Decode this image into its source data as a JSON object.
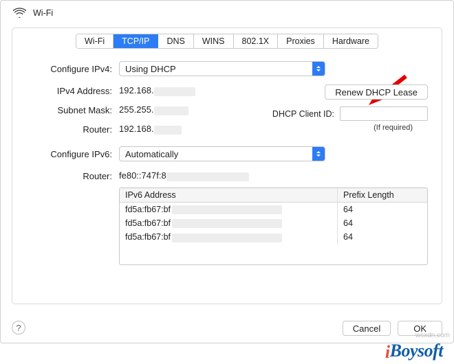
{
  "header": {
    "title": "Wi-Fi"
  },
  "tabs": [
    "Wi-Fi",
    "TCP/IP",
    "DNS",
    "WINS",
    "802.1X",
    "Proxies",
    "Hardware"
  ],
  "active_tab_index": 1,
  "labels": {
    "configure_ipv4": "Configure IPv4:",
    "ipv4_address": "IPv4 Address:",
    "subnet_mask": "Subnet Mask:",
    "router": "Router:",
    "configure_ipv6": "Configure IPv6:",
    "router6": "Router:",
    "dhcp_client_id": "DHCP Client ID:",
    "if_required": "(If required)"
  },
  "values": {
    "configure_ipv4": "Using DHCP",
    "ipv4_address": "192.168.",
    "subnet_mask": "255.255.",
    "router": "192.168.",
    "configure_ipv6": "Automatically",
    "router6": "fe80::747f:8",
    "dhcp_client_id": ""
  },
  "buttons": {
    "renew": "Renew DHCP Lease",
    "cancel": "Cancel",
    "ok": "OK"
  },
  "ipv6_table": {
    "headers": [
      "IPv6 Address",
      "Prefix Length"
    ],
    "rows": [
      {
        "addr": "fd5a:fb67:bf",
        "prefix": "64"
      },
      {
        "addr": "fd5a:fb67:bf",
        "prefix": "64"
      },
      {
        "addr": "fd5a:fb67:bf",
        "prefix": "64"
      }
    ]
  },
  "watermark": "iBoysoft",
  "side_text": "wsxdn.com"
}
